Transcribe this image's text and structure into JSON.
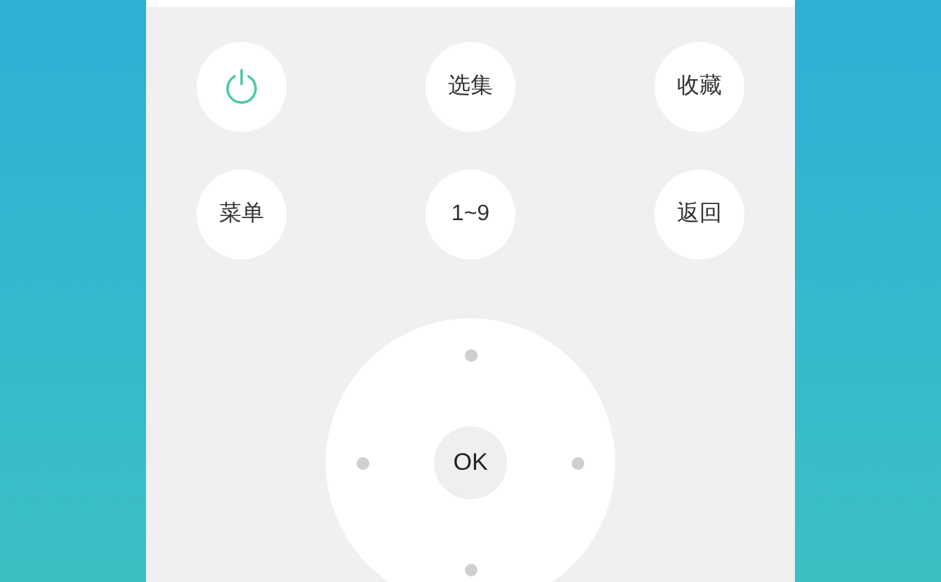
{
  "buttons": [
    {
      "kind": "power"
    },
    {
      "kind": "text",
      "label": "选集"
    },
    {
      "kind": "text",
      "label": "收藏"
    },
    {
      "kind": "text",
      "label": "菜单"
    },
    {
      "kind": "text",
      "label": "1~9"
    },
    {
      "kind": "text",
      "label": "返回"
    }
  ],
  "dpad": {
    "ok": "OK"
  }
}
